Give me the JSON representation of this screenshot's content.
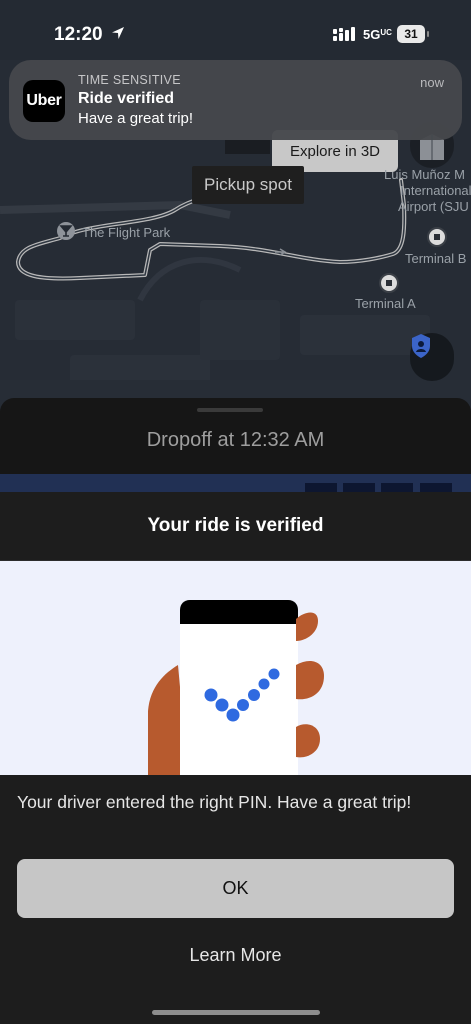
{
  "status_bar": {
    "time": "12:20",
    "network": "5G",
    "network_suffix": "UC",
    "battery": "31"
  },
  "notification": {
    "app_icon_text": "Uber",
    "tag": "TIME SENSITIVE",
    "time": "now",
    "title": "Ride verified",
    "body": "Have a great trip!"
  },
  "map": {
    "explore_button": "Explore in 3D",
    "pickup_label": "Pickup spot",
    "flight_park_label": "The Flight Park",
    "airport_label_line1": "Luis Muñoz M",
    "airport_label_line2": "International",
    "airport_label_line3": "Airport (SJU",
    "terminal_b_label": "Terminal B",
    "terminal_a_label": "Terminal A"
  },
  "trip": {
    "dropoff_text": "Dropoff at 12:32 AM"
  },
  "modal": {
    "title": "Your ride is verified",
    "message": "Your driver entered the right PIN. Have a great trip!",
    "ok_label": "OK",
    "learn_more_label": "Learn More"
  },
  "colors": {
    "map_background": "#242a33",
    "illustration_background": "#eef1fc",
    "check_dots": "#2f6ae0",
    "hand": "#b75a2e",
    "button": "#c6c6c6"
  }
}
